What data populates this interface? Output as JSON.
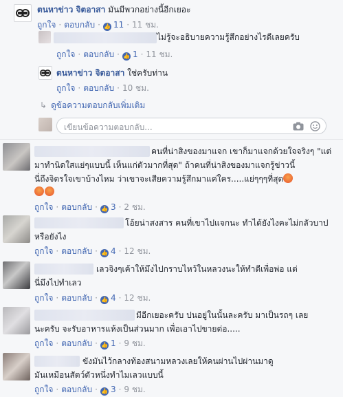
{
  "thread": {
    "top": {
      "author": "ตนหาข่าว จิตอาสา",
      "text": "มันมีพวกอย่างนี้อีกเยอะ",
      "like_label": "ถูกใจ",
      "reply_label": "ตอบกลับ",
      "likes": "11",
      "time": "11 ชม."
    },
    "replies": [
      {
        "text": "ไม่รู้จะอธิบายความรู้สึกอย่างไรดีเลยครับ",
        "like_label": "ถูกใจ",
        "reply_label": "ตอบกลับ",
        "likes": "1",
        "time": "11 ชม."
      },
      {
        "author": "ตนหาข่าว จิตอาสา",
        "text": "ใช่ครับท่าน",
        "like_label": "ถูกใจ",
        "reply_label": "ตอบกลับ",
        "time": "10 ชม."
      }
    ],
    "more_replies": "ดูข้อความตอบกลับเพิ่มเติม",
    "reply_placeholder": "เขียนข้อความตอบกลับ..."
  },
  "comments": [
    {
      "line1": "คนที่น่าสิงของมาแจก เขาก็มาแจกด้วยใจจริงๆ \"แต่",
      "line2": "มาทำนิดใสแย่ๆแบบนี้ เห็นแก่ตัวมากที่สุด\" ถ้าคนที่น่าสิงของมาแจกรู้ข่าวนี้",
      "line3": "นี่ถึงจิตรใจเขาบ้างไหม ว่าเขาจะเสียความรู้สึกมาแค่ใคร.....แย่ๆๆๆที่สุด",
      "like_label": "ถูกใจ",
      "reply_label": "ตอบกลับ",
      "likes": "3",
      "time": "2 ชม."
    },
    {
      "line1": "โอ้ยน่าสงสาร คนที่เขาไปแจกนะ ทำได้ยังไงคะไม่กลัวบาป",
      "line2": "หรือยังไง",
      "like_label": "ถูกใจ",
      "reply_label": "ตอบกลับ",
      "likes": "4",
      "time": "12 ชม."
    },
    {
      "line1": "เลวจิงๆเค้าให้มึงไปกราบไหว้ในหลวงนะให้ทำดีเพื่อพ่อ แต่",
      "line2": "นี่มึงไปทำเลว",
      "like_label": "ถูกใจ",
      "reply_label": "ตอบกลับ",
      "likes": "4",
      "time": "12 ชม."
    },
    {
      "line1": "มีอีกเยอะครับ ปนอยู่ในนั้นละครับ มาเป็นรถๆ เลย",
      "line2": "นะครับ จะรับอาหารแห้งเป็นส่วนมาก เพื่อเอาไปขายต่อ.....",
      "like_label": "ถูกใจ",
      "reply_label": "ตอบกลับ",
      "likes": "1",
      "time": "9 ชม."
    },
    {
      "line1": "ขังมันไว้กลางท้องสนามหลวงเลยให้คนผ่านไปผ่านมาดู",
      "line2": "มันเหมือนสัตว์ตัวหนึ่งทำไมเลวแบบนี้",
      "like_label": "ถูกใจ",
      "reply_label": "ตอบกลับ",
      "likes": "3",
      "time": "9 ชม."
    }
  ]
}
